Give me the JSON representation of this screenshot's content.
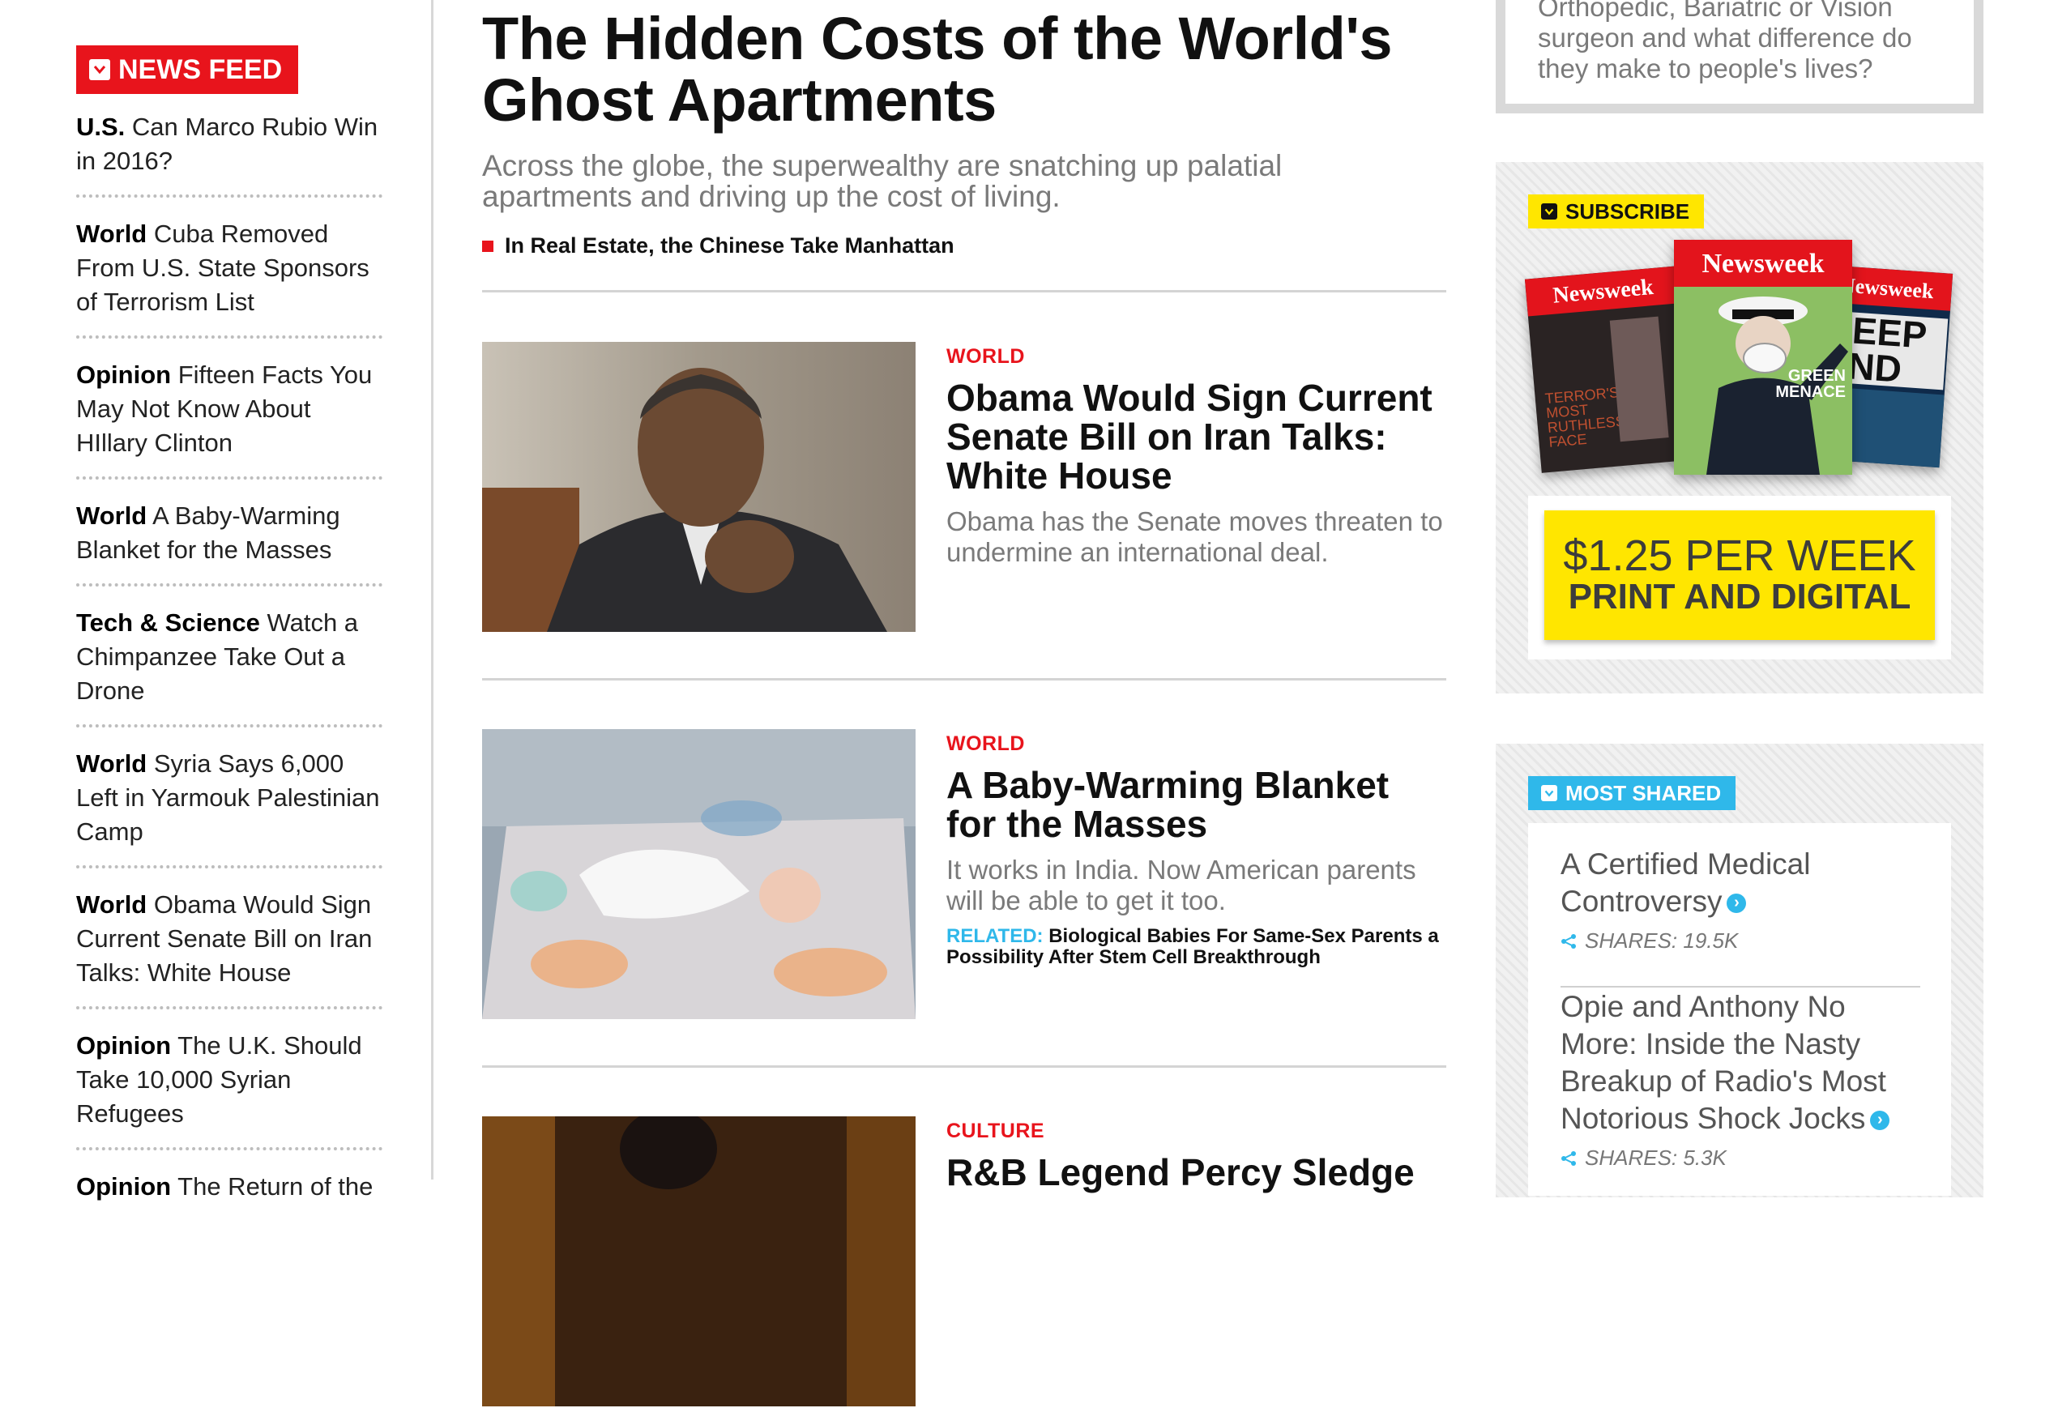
{
  "feed": {
    "label": "NEWS FEED",
    "items": [
      {
        "cat": "U.S.",
        "text": "Can Marco Rubio Win in 2016?"
      },
      {
        "cat": "World",
        "text": "Cuba Removed From U.S. State Sponsors of Terrorism List"
      },
      {
        "cat": "Opinion",
        "text": "Fifteen Facts You May Not Know About HIllary Clinton"
      },
      {
        "cat": "World",
        "text": "A Baby-Warming Blanket for the Masses"
      },
      {
        "cat": "Tech & Science",
        "text": "Watch a Chimpanzee Take Out a Drone"
      },
      {
        "cat": "World",
        "text": "Syria Says 6,000 Left in Yarmouk Palestinian Camp"
      },
      {
        "cat": "World",
        "text": "Obama Would Sign Current Senate Bill on Iran Talks: White House"
      },
      {
        "cat": "Opinion",
        "text": "The U.K. Should Take 10,000 Syrian Refugees"
      },
      {
        "cat": "Opinion",
        "text": "The Return of the"
      }
    ]
  },
  "hero": {
    "title": "The Hidden Costs of the World's Ghost Apartments",
    "dek": "Across the globe, the superwealthy are snatching up palatial apartments and driving up the cost of living.",
    "related": "In Real Estate, the Chinese Take Manhattan"
  },
  "stories": [
    {
      "kicker": "WORLD",
      "title": "Obama Would Sign Current Senate Bill on Iran Talks: White House",
      "dek": "Obama has the Senate moves threaten to undermine an international deal."
    },
    {
      "kicker": "WORLD",
      "title": "A Baby-Warming Blanket for the Masses",
      "dek": "It works in India. Now American parents will be able to get it too.",
      "related_label": "RELATED:",
      "related_text": "Biological Babies For Same-Sex Parents a Possibility After Stem Cell Breakthrough"
    },
    {
      "kicker": "CULTURE",
      "title": "R&B Legend Percy Sledge"
    }
  ],
  "promo": {
    "lines": [
      "Orthopedic, Bariatric or Vision",
      "surgeon and what difference do",
      "they make to people's lives?"
    ]
  },
  "subscribe": {
    "label": "SUBSCRIBE",
    "covers": [
      {
        "mast": "Newsweek",
        "headline": "TERROR'S MOST RUTHLESS FACE"
      },
      {
        "mast": "Newsweek",
        "headline": "GREEN MENACE"
      },
      {
        "mast": "Newsweek",
        "headline": "DEEP END"
      }
    ],
    "price_line1": "$1.25 PER WEEK",
    "price_line2": "PRINT AND DIGITAL"
  },
  "most_shared": {
    "label": "MOST SHARED",
    "items": [
      {
        "title": "A Certified Medical Controversy",
        "shares": "SHARES: 19.5K"
      },
      {
        "title": "Opie and Anthony No More: Inside the Nasty Breakup of Radio's Most Notorious Shock Jocks",
        "shares": "SHARES: 5.3K"
      }
    ]
  },
  "colors": {
    "accent_red": "#e8141c",
    "accent_cyan": "#2fb8ea",
    "accent_yellow": "#ffe600"
  },
  "icons": [
    "newsfeed-badge-icon",
    "subscribe-badge-icon",
    "most-shared-badge-icon",
    "arrow-circle-icon",
    "share-icon"
  ]
}
